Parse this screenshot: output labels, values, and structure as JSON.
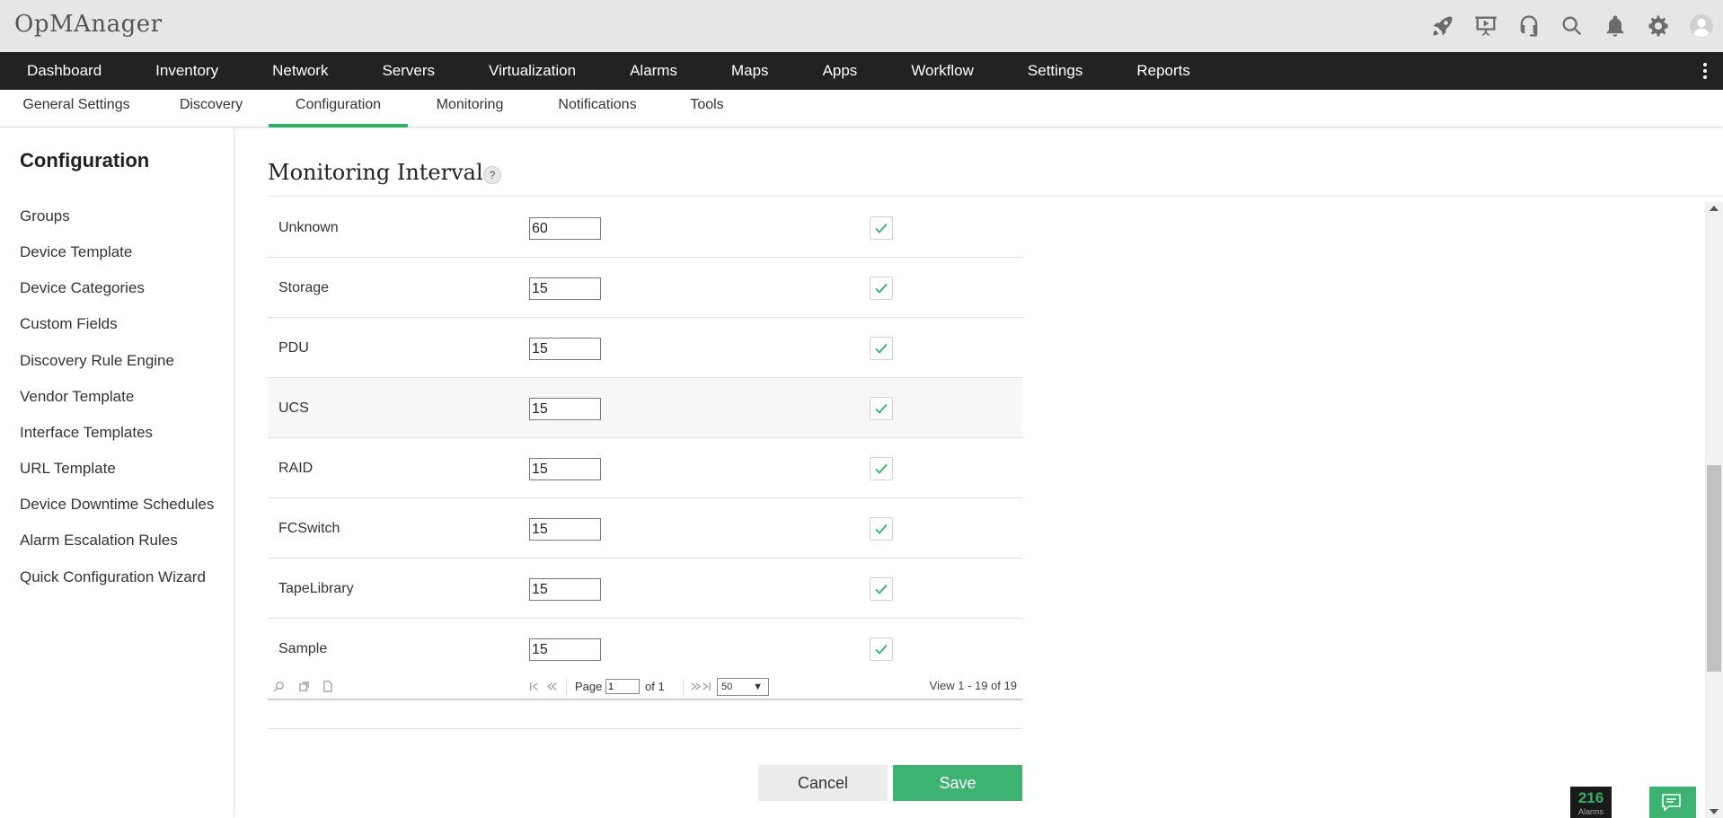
{
  "app": {
    "title": "OpMAnager"
  },
  "top_icons": [
    "rocket-icon",
    "presentation-icon",
    "headset-icon",
    "search-icon",
    "bell-icon",
    "gear-icon",
    "user-avatar-icon"
  ],
  "main_nav": {
    "items": [
      "Dashboard",
      "Inventory",
      "Network",
      "Servers",
      "Virtualization",
      "Alarms",
      "Maps",
      "Apps",
      "Workflow",
      "Settings",
      "Reports"
    ]
  },
  "sub_nav": {
    "items": [
      "General Settings",
      "Discovery",
      "Configuration",
      "Monitoring",
      "Notifications",
      "Tools"
    ],
    "active": "Configuration"
  },
  "sidebar": {
    "title": "Configuration",
    "items": [
      "Groups",
      "Device Template",
      "Device Categories",
      "Custom Fields",
      "Discovery Rule Engine",
      "Vendor Template",
      "Interface Templates",
      "URL Template",
      "Device Downtime Schedules",
      "Alarm Escalation Rules",
      "Quick Configuration Wizard"
    ]
  },
  "main": {
    "title": "Monitoring Interval",
    "help": "?",
    "rows": [
      {
        "name": "Unknown",
        "interval": "60",
        "enabled": true
      },
      {
        "name": "Storage",
        "interval": "15",
        "enabled": true
      },
      {
        "name": "PDU",
        "interval": "15",
        "enabled": true
      },
      {
        "name": "UCS",
        "interval": "15",
        "enabled": true
      },
      {
        "name": "RAID",
        "interval": "15",
        "enabled": true
      },
      {
        "name": "FCSwitch",
        "interval": "15",
        "enabled": true
      },
      {
        "name": "TapeLibrary",
        "interval": "15",
        "enabled": true
      },
      {
        "name": "Sample",
        "interval": "15",
        "enabled": true
      }
    ]
  },
  "pager": {
    "page_label": "Page",
    "page_value": "1",
    "of_label": "of 1",
    "per_page": "50",
    "view_label": "View 1 - 19 of 19"
  },
  "buttons": {
    "cancel": "Cancel",
    "save": "Save"
  },
  "alarm_badge": {
    "count": "216",
    "label": "Alarms"
  },
  "colors": {
    "accent": "#2db36a",
    "nav_bg": "#222222",
    "topbar_bg": "#e6e6e6"
  }
}
